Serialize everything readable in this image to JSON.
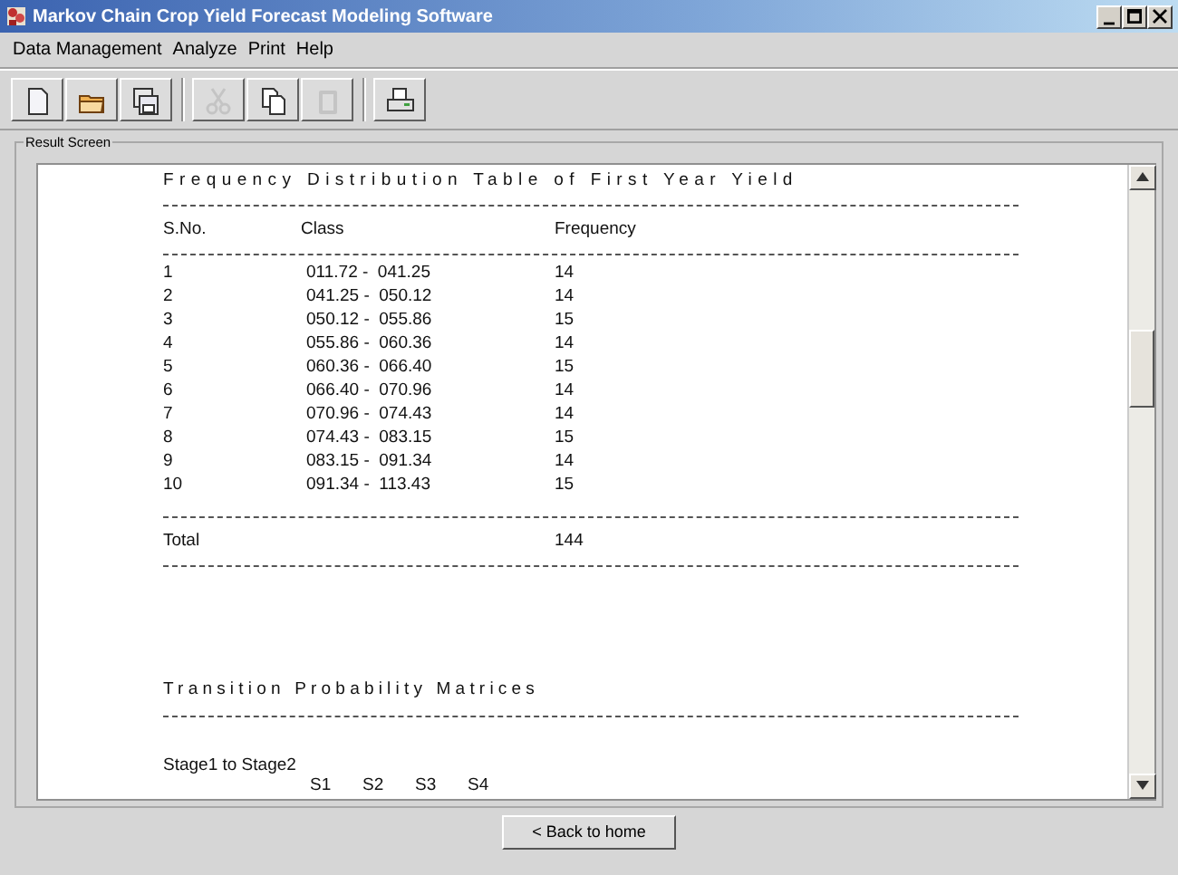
{
  "window": {
    "title": "Markov Chain Crop Yield Forecast Modeling Software"
  },
  "menu": [
    {
      "label": "Data Management"
    },
    {
      "label": "Analyze"
    },
    {
      "label": "Print"
    },
    {
      "label": "Help"
    }
  ],
  "toolbar": [
    {
      "kind": "new",
      "disabled": false
    },
    {
      "kind": "open",
      "disabled": false
    },
    {
      "kind": "save",
      "disabled": false
    },
    {
      "kind": "separator"
    },
    {
      "kind": "cut",
      "disabled": true
    },
    {
      "kind": "copy",
      "disabled": false
    },
    {
      "kind": "paste",
      "disabled": true
    },
    {
      "kind": "separator"
    },
    {
      "kind": "print",
      "disabled": false
    }
  ],
  "panel": {
    "title": "Result Screen"
  },
  "frequency_table": {
    "title": "Frequency Distribution Table of First Year Yield",
    "columns": [
      "S.No.",
      "Class",
      "Frequency"
    ],
    "rows": [
      {
        "sno": "1",
        "class": "011.72 -  041.25",
        "frequency": "14"
      },
      {
        "sno": "2",
        "class": "041.25 -  050.12",
        "frequency": "14"
      },
      {
        "sno": "3",
        "class": "050.12 -  055.86",
        "frequency": "15"
      },
      {
        "sno": "4",
        "class": "055.86 -  060.36",
        "frequency": "14"
      },
      {
        "sno": "5",
        "class": "060.36 -  066.40",
        "frequency": "15"
      },
      {
        "sno": "6",
        "class": "066.40 -  070.96",
        "frequency": "14"
      },
      {
        "sno": "7",
        "class": "070.96 -  074.43",
        "frequency": "14"
      },
      {
        "sno": "8",
        "class": "074.43 -  083.15",
        "frequency": "15"
      },
      {
        "sno": "9",
        "class": "083.15 -  091.34",
        "frequency": "14"
      },
      {
        "sno": "10",
        "class": "091.34 -  113.43",
        "frequency": "15"
      }
    ],
    "total_label": "Total",
    "total": "144"
  },
  "transition": {
    "title": "Transition Probability Matrices",
    "stage": "Stage1 to Stage2",
    "states": [
      "S1",
      "S2",
      "S3",
      "S4"
    ]
  },
  "back_button": "< Back to home"
}
